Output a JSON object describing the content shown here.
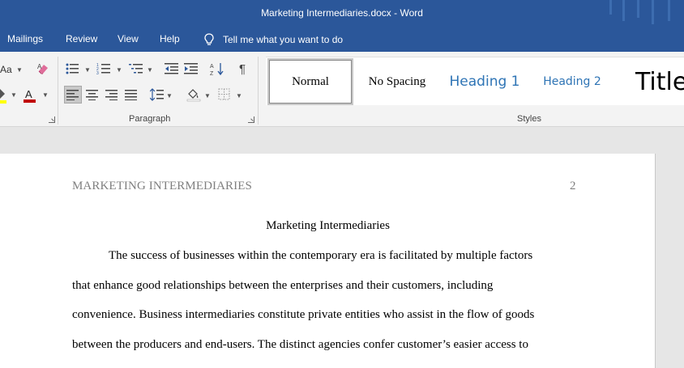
{
  "window": {
    "title": "Marketing Intermediaries.docx  -  Word"
  },
  "menu": {
    "tabs": [
      "Mailings",
      "Review",
      "View",
      "Help"
    ],
    "tell_me": "Tell me what you want to do"
  },
  "ribbon": {
    "font_group": {
      "change_case_label": "Aa"
    },
    "paragraph_label": "Paragraph",
    "styles_label": "Styles",
    "styles": [
      "Normal",
      "No Spacing",
      "Heading 1",
      "Heading 2",
      "Title"
    ]
  },
  "document": {
    "header_left": "MARKETING INTERMEDIARIES",
    "page_number": "2",
    "title": "Marketing Intermediaries",
    "lines": [
      "The success of businesses within the contemporary era is facilitated by multiple factors",
      "that enhance good relationships between the enterprises and their customers, including",
      "convenience. Business intermediaries constitute private entities who assist in the flow of goods",
      "between the producers and end-users. The distinct agencies confer customer’s easier access to"
    ]
  },
  "colors": {
    "brand": "#2b579a",
    "ribbon_bg": "#f3f3f3",
    "heading_blue": "#2e74b5",
    "header_gray": "#7f7f7f",
    "font_color_red": "#c00000",
    "highlight_yellow": "#ffff00"
  }
}
